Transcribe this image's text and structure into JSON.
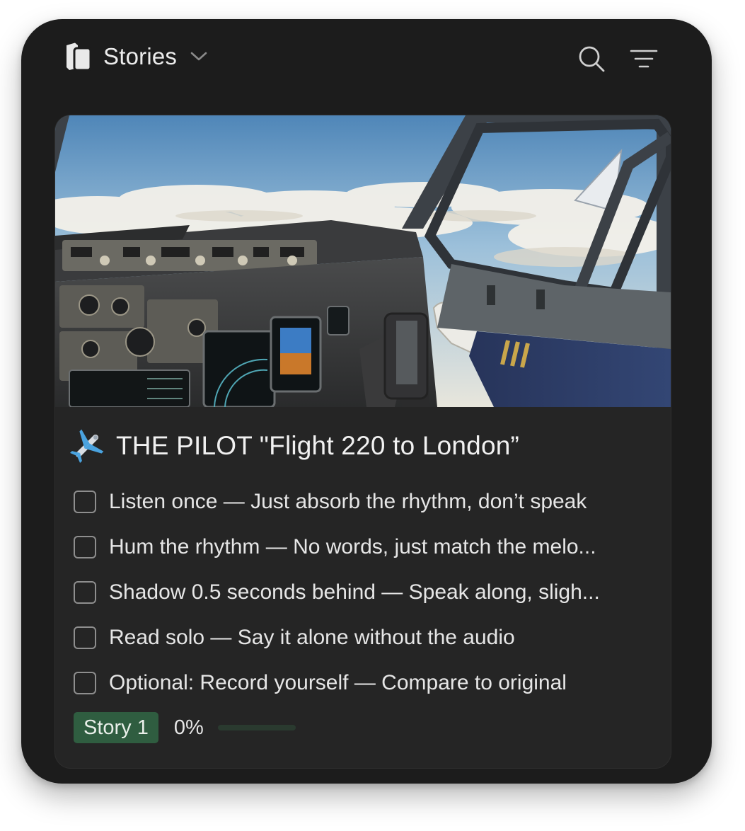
{
  "header": {
    "database_title": "Stories",
    "icons": {
      "database": "pages-stack-icon",
      "dropdown": "chevron-down-icon",
      "search": "search-icon",
      "filter": "filter-lines-icon"
    }
  },
  "card": {
    "cover": {
      "icon": "cockpit-illustration"
    },
    "title_icon": "airplane-emoji",
    "title": "THE PILOT \"Flight 220 to London”",
    "todos": [
      {
        "label": "Listen once — Just absorb the rhythm, don’t speak",
        "checked": false
      },
      {
        "label": "Hum the rhythm — No words, just match the melo...",
        "checked": false
      },
      {
        "label": "Shadow 0.5 seconds behind — Speak along, sligh...",
        "checked": false
      },
      {
        "label": "Read solo — Say it alone without the audio",
        "checked": false
      },
      {
        "label": "Optional: Record yourself — Compare to original",
        "checked": false
      }
    ],
    "tag": "Story 1",
    "progress_text": "0%",
    "progress_value": 0,
    "colors": {
      "tag_bg": "#2f5d40",
      "progress_fill": "#3f8a5a",
      "card_bg": "#252525",
      "widget_bg": "#1c1c1c"
    }
  }
}
